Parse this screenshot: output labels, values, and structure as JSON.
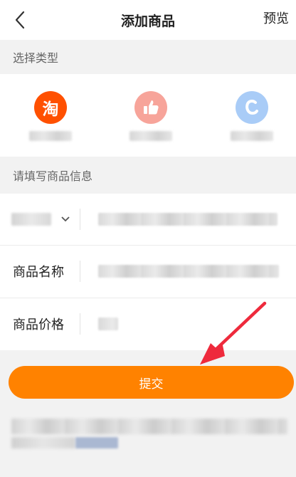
{
  "header": {
    "title": "添加商品",
    "preview_label": "预览",
    "back_icon": "chevron-left-icon"
  },
  "type_section": {
    "title": "选择类型",
    "items": [
      {
        "icon": "taobao-icon",
        "glyph": "淘",
        "color": "#ff5000"
      },
      {
        "icon": "thumbs-up-icon",
        "color": "#f7a49a"
      },
      {
        "icon": "c-letter-icon",
        "color": "#a9ccf7"
      }
    ]
  },
  "info_section": {
    "title": "请填写商品信息",
    "fields": [
      {
        "label": "商品名称"
      },
      {
        "label": "商品价格"
      }
    ]
  },
  "submit": {
    "label": "提交",
    "color": "#ff8200"
  },
  "annotation": {
    "arrow_color": "#ee2a3c"
  }
}
